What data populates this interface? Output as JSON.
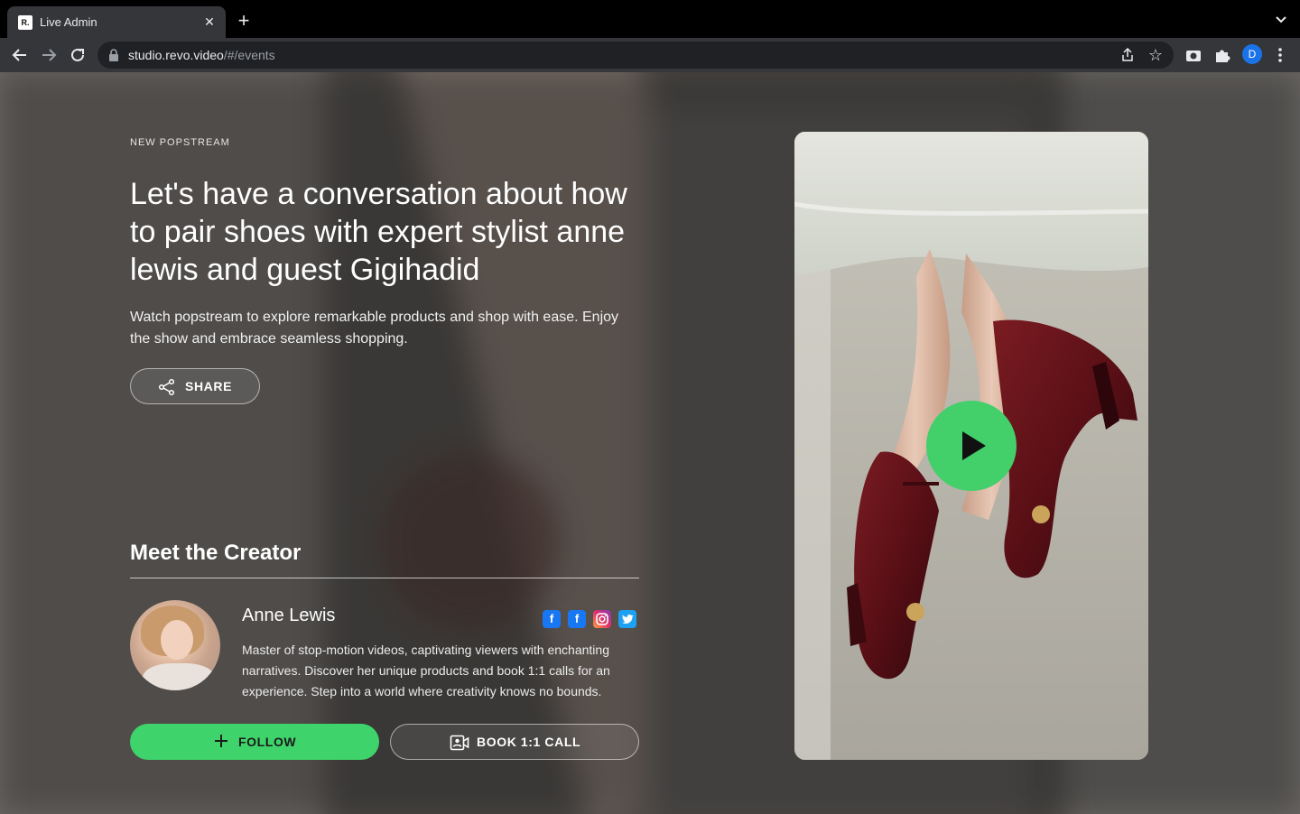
{
  "browser": {
    "tab_title": "Live Admin",
    "favicon_text": "R.",
    "url_host": "studio.revo.video",
    "url_path": "/#/events",
    "profile_initial": "D"
  },
  "hero": {
    "eyebrow": "NEW POPSTREAM",
    "headline": "Let's have a conversation about how to pair shoes with expert stylist anne lewis and guest Gigihadid",
    "description": "Watch popstream to explore remarkable products and shop with ease. Enjoy the show and embrace seamless shopping.",
    "share_label": "SHARE"
  },
  "creator": {
    "section_title": "Meet the Creator",
    "name": "Anne Lewis",
    "bio": "Master of stop-motion videos, captivating viewers with enchanting narratives. Discover her unique products and book 1:1 calls for an experience. Step into a world where creativity knows no bounds.",
    "socials": [
      "facebook-icon",
      "facebook-icon",
      "instagram-icon",
      "twitter-icon"
    ],
    "follow_label": "FOLLOW",
    "book_label": "BOOK 1:1 CALL"
  },
  "colors": {
    "accent_green": "#3fd46b",
    "facebook": "#1877f2",
    "instagram": "#c13584",
    "twitter": "#1da1f2"
  }
}
